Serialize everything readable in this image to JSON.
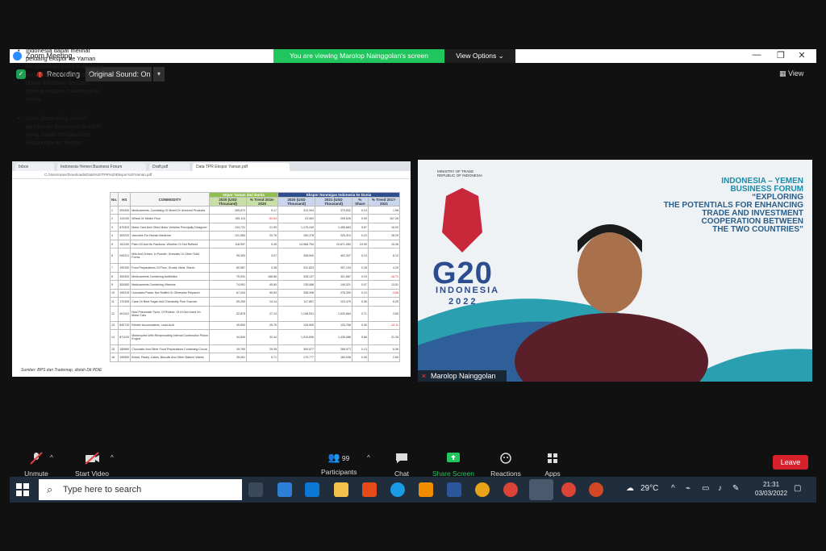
{
  "window": {
    "title": "Zoom Meeting",
    "viewing_banner": "You are viewing Marolop Nainggolan's screen",
    "view_options": "View Options",
    "minimize": "—",
    "restore": "❐",
    "close": "✕"
  },
  "status": {
    "recording": "Recording",
    "original_sound": "Original Sound: On",
    "view": "View"
  },
  "shared_screen": {
    "tabs": [
      "Inbox",
      "Indonesia-Yemen Business Forum",
      "Draft.pdf",
      "Data TPR Ekspor Yaman.pdf"
    ],
    "url": "C:/Users/user/Downloads/Data%20TPR%20Ekspor%20Yaman.pdf",
    "bullets": [
      "Indonesia dapat melihat peluang ekspor ke Yaman berdasarkan produk apa saja yang diimpor Yaman dari dunia dikaitkan dengan produk ekspor Indonesia ke dunia.",
      "Data disamping adalah gambaran beberapa produk yang dapat ditingkatkan ekspornya ke Yaman."
    ],
    "source": "Sumber: BPS dan Trademap, diolah Dit PDIE",
    "table": {
      "col_no": "No.",
      "col_hs": "HS",
      "col_commodity": "COMMODITY",
      "group_yemen": "Impor Yaman dari Dunia",
      "group_indo": "Ekspor Nonmigas Indonesia ke Dunia",
      "sub_2020": "2020 (USD Thousand)",
      "sub_trend": "% Trend 2016-2020",
      "sub_2020b": "2020 (USD Thousand)",
      "sub_2021": "2021 (USD Thousand)",
      "sub_share": "% Share",
      "sub_trend2": "% Trend 2017-2021",
      "rows": [
        [
          "1",
          "300490",
          "Medicaments, Consisting Of Mixed Or Unmixed Products",
          "265,870",
          "5.17",
          "313,394",
          "370,832",
          "0.14",
          "1.98"
        ],
        [
          "2",
          "110100",
          "Wheat Or Meslin Flour",
          "155,113",
          "-52.64",
          "23,063",
          "205,626",
          "0.09",
          "167.28"
        ],
        [
          "3",
          "870323",
          "Motor Cars And Other Motor Vehicles Principally Designed",
          "134,721",
          "21.95",
          "1,175,240",
          "1,455,863",
          "0.67",
          "16.92"
        ],
        [
          "4",
          "300220",
          "Vaccines For Human Medicine",
          "131,083",
          "20.76",
          "150,378",
          "225,310",
          "0.10",
          "28.29"
        ],
        [
          "5",
          "151190",
          "Palm Oil And Its Fractions, Whether Or Not Refined",
          "118,997",
          "0.26",
          "14,568,754",
          "23,871,550",
          "10.99",
          "15.36"
        ],
        [
          "6",
          "040221",
          "Milk And Cream, In Powder, Granules Or Other Solid Forms",
          "95,393",
          "3.07",
          "308,500",
          "402,347",
          "0.19",
          "8.12"
        ],
        [
          "7",
          "190190",
          "Food Preparations Of Flour, Groats, Meal, Starch",
          "80,587",
          "3.38",
          "312,823",
          "397,153",
          "0.18",
          "4.29"
        ],
        [
          "8",
          "300420",
          "Medicaments Containing Antibiotics",
          "75,931",
          "166.86",
          "328,137",
          "321,667",
          "0.15",
          "-16.71"
        ],
        [
          "9",
          "300450",
          "Medicaments Containing Vitamins",
          "74,951",
          "45.80",
          "135,088",
          "149,321",
          "0.07",
          "13.51"
        ],
        [
          "10",
          "190219",
          "Uncooked Pasta, Not Stuffed Or Otherwise Prepared",
          "67,434",
          "50.69",
          "338,398",
          "276,300",
          "0.13",
          "-3.06"
        ],
        [
          "11",
          "170199",
          "Cane Or Beet Sugar And Chemically Pure Sucrose",
          "55,290",
          "14.14",
          "117,857",
          "123,479",
          "0.06",
          "6.09"
        ],
        [
          "12",
          "401110",
          "New Pneumatic Tyres, Of Rubber, Of A Kind Used On Motor Cars",
          "52,878",
          "27.14",
          "1,198,531",
          "1,533,864",
          "0.71",
          "3.60"
        ],
        [
          "13",
          "840710",
          "Electric Accumulators, Lead-Acid",
          "49,650",
          "25.76",
          "128,905",
          "133,768",
          "0.06",
          "-12.11"
        ],
        [
          "14",
          "871120",
          "Motorcycles With Reciprocating Internal Combustion Piston Engine",
          "44,509",
          "32.44",
          "1,315,606",
          "1,439,086",
          "0.66",
          "31.39"
        ],
        [
          "15",
          "180690",
          "Chocolate And Other Food Preparations Containing Cocoa",
          "39,790",
          "25.35",
          "300,577",
          "285,073",
          "0.13",
          "6.36"
        ],
        [
          "16",
          "190590",
          "Bread, Pastry, Cakes, Biscuits And Other Bakers' Wares",
          "35,061",
          "5.71",
          "179,777",
          "183,008",
          "0.08",
          "2.60"
        ]
      ]
    }
  },
  "speaker": {
    "name": "Marolop Nainggolan",
    "ministry": "MINISTRY OF TRADE REPUBLIC OF INDONESIA",
    "forum_line1": "INDONESIA – YEMEN",
    "forum_line2": "BUSINESS FORUM",
    "forum_line3": "“EXPLORING",
    "forum_line4": "THE POTENTIALS FOR ENHANCING",
    "forum_line5": "TRADE AND INVESTMENT",
    "forum_line6": "COOPERATION BETWEEN",
    "forum_line7": "THE TWO COUNTRIES”",
    "g20": "G20",
    "g20_country": "INDONESIA",
    "g20_year": "2022"
  },
  "controls": {
    "unmute": "Unmute",
    "start_video": "Start Video",
    "participants": "Participants",
    "participants_count": "99",
    "chat": "Chat",
    "share_screen": "Share Screen",
    "reactions": "Reactions",
    "apps": "Apps",
    "leave": "Leave"
  },
  "taskbar": {
    "search_placeholder": "Type here to search",
    "weather": "29°C",
    "time": "21:31",
    "date": "03/03/2022"
  },
  "colors": {
    "share_green": "#21c55d",
    "leave_red": "#d8202a",
    "zoom_blue": "#2d8cff"
  }
}
